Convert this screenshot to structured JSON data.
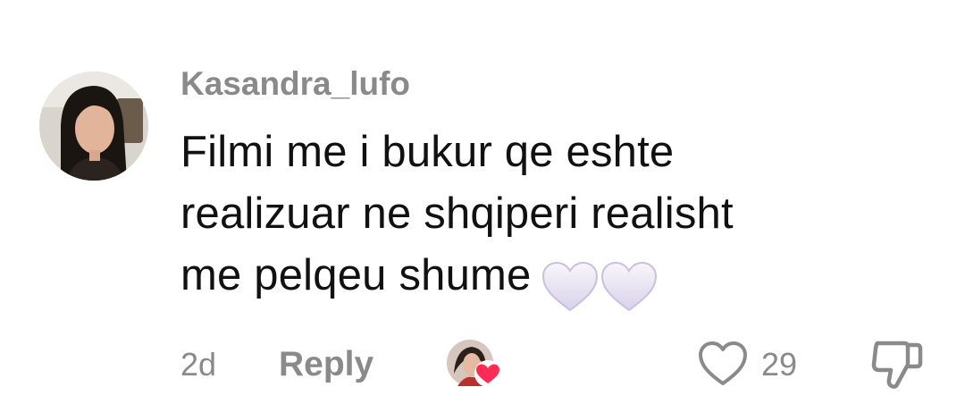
{
  "comment": {
    "username": "Kasandra_lufo",
    "text_lines": [
      "Filmi me i bukur qe eshte",
      "realizuar ne shqiperi realisht",
      "me pelqeu shume"
    ],
    "emojis": [
      "white-heart-icon",
      "white-heart-icon"
    ],
    "time": "2d",
    "reply_label": "Reply",
    "like_count": "29",
    "liked_by_creator": true
  },
  "colors": {
    "meta_gray": "#8a8a8a",
    "text": "#111111",
    "creator_heart": "#fe2c55"
  }
}
